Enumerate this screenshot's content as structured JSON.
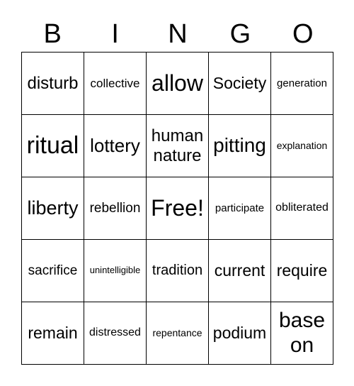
{
  "header": [
    "B",
    "I",
    "N",
    "G",
    "O"
  ],
  "cells": [
    "disturb",
    "collective",
    "allow",
    "Society",
    "generation",
    "ritual",
    "lottery",
    "human nature",
    "pitting",
    "explanation",
    "liberty",
    "rebellion",
    "Free!",
    "participate",
    "obliterated",
    "sacrifice",
    "unintelligible",
    "tradition",
    "current",
    "require",
    "remain",
    "distressed",
    "repentance",
    "podium",
    "base on"
  ]
}
